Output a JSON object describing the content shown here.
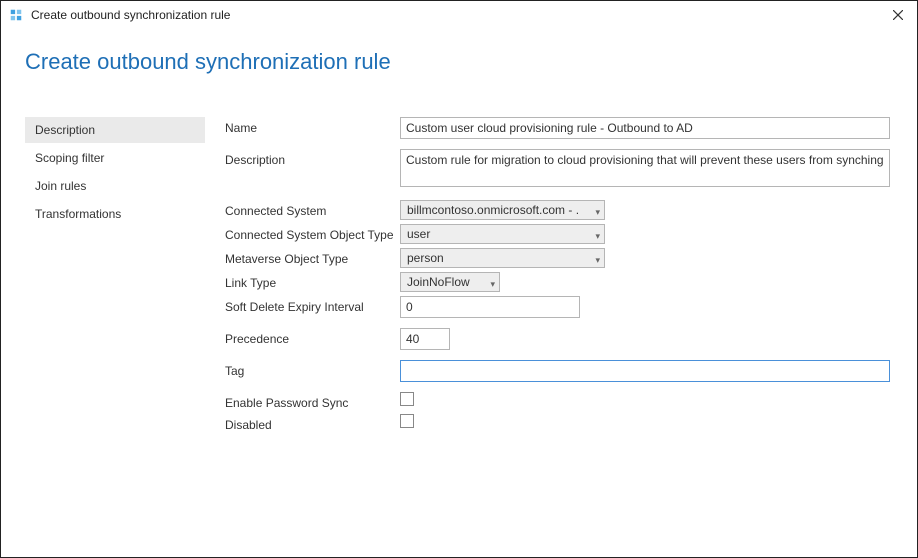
{
  "window": {
    "title": "Create outbound synchronization rule"
  },
  "heading": "Create outbound synchronization rule",
  "nav": {
    "items": [
      {
        "label": "Description",
        "active": true
      },
      {
        "label": "Scoping filter",
        "active": false
      },
      {
        "label": "Join rules",
        "active": false
      },
      {
        "label": "Transformations",
        "active": false
      }
    ]
  },
  "form": {
    "name_label": "Name",
    "name_value": "Custom user cloud provisioning rule - Outbound to AD",
    "description_label": "Description",
    "description_value": "Custom rule for migration to cloud provisioning that will prevent these users from synching",
    "connected_system_label": "Connected System",
    "connected_system_value": "billmcontoso.onmicrosoft.com - .",
    "csot_label": "Connected System Object Type",
    "csot_value": "user",
    "mvot_label": "Metaverse Object Type",
    "mvot_value": "person",
    "linktype_label": "Link Type",
    "linktype_value": "JoinNoFlow",
    "softdelete_label": "Soft Delete Expiry Interval",
    "softdelete_value": "0",
    "precedence_label": "Precedence",
    "precedence_value": "40",
    "tag_label": "Tag",
    "tag_value": "",
    "enable_pw_sync_label": "Enable Password Sync",
    "enable_pw_sync_checked": false,
    "disabled_label": "Disabled",
    "disabled_checked": false
  }
}
